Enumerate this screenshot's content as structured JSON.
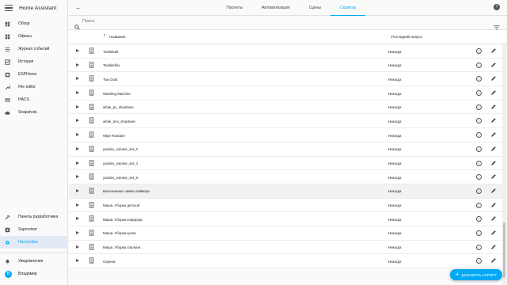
{
  "app": {
    "title": "Home Assistant",
    "accent": "#03a9f4"
  },
  "sidebar": {
    "items": [
      {
        "label": "Обзор",
        "icon": "dashboard-icon"
      },
      {
        "label": "Офисы",
        "icon": "office-icon"
      },
      {
        "label": "Журнал событий",
        "icon": "logbook-icon"
      },
      {
        "label": "История",
        "icon": "history-icon"
      },
      {
        "label": "ESPHome",
        "icon": "esphome-icon"
      },
      {
        "label": "File editor",
        "icon": "wrench-icon"
      },
      {
        "label": "HACS",
        "icon": "hacs-icon"
      },
      {
        "label": "Snapshots",
        "icon": "cloud-icon"
      }
    ],
    "bottom": [
      {
        "label": "Панель разработчика",
        "icon": "hammer-icon"
      },
      {
        "label": "Supervisor",
        "icon": "supervisor-icon"
      },
      {
        "label": "Настройки",
        "icon": "gear-icon",
        "active": true
      }
    ],
    "notifications": "Уведомления",
    "user": {
      "initial": "В",
      "name": "Владимир"
    }
  },
  "tabs": [
    "Проекты",
    "Автоматизации",
    "Сцены",
    "Скрипты"
  ],
  "active_tab": "Скрипты",
  "search": {
    "placeholder": "Поиск"
  },
  "table": {
    "col_name": "Название",
    "col_last": "Последний запуск",
    "rows": [
      {
        "name": "Twinkleall",
        "last": "Никогда"
      },
      {
        "name": "Twinkleflux",
        "last": "Никогда"
      },
      {
        "name": "Two Dots",
        "last": "Никогда"
      },
      {
        "name": "Washing Machine",
        "last": "Никогда"
      },
      {
        "name": "white_pc_shutdown",
        "last": "Никогда"
      },
      {
        "name": "white_tvrv_shutdown",
        "last": "Никогда"
      },
      {
        "name": "Wipe Random",
        "last": "Никогда"
      },
      {
        "name": "yandex_volume_set_2",
        "last": "Никогда"
      },
      {
        "name": "yandex_volume_set_4",
        "last": "Никогда"
      },
      {
        "name": "yandex_volume_set_8",
        "last": "Никогда"
      },
      {
        "name": "Выключение лампы пайвера",
        "last": "Никогда"
      },
      {
        "name": "Маша. Уборка детской",
        "last": "Никогда"
      },
      {
        "name": "Маша. Уборка коридора",
        "last": "Никогда"
      },
      {
        "name": "Маша. Уборка кухни",
        "last": "Никогда"
      },
      {
        "name": "Маша. Уборка спальни",
        "last": "Никогда"
      },
      {
        "name": "Сирена",
        "last": "Никогда"
      }
    ]
  },
  "fab": {
    "label": "ДОБАВИТЬ СКРИПТ"
  }
}
